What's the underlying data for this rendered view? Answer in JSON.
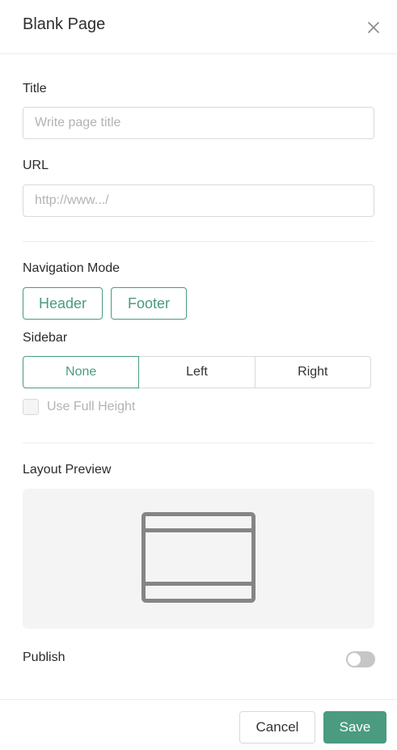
{
  "dialog": {
    "title": "Blank Page",
    "close_icon": "close-icon"
  },
  "form": {
    "title_label": "Title",
    "title_placeholder": "Write page title",
    "title_value": "",
    "url_label": "URL",
    "url_placeholder": "http://www.../",
    "url_value": "",
    "navigation_label": "Navigation Mode",
    "navigation_options": [
      "Header",
      "Footer"
    ],
    "sidebar_label": "Sidebar",
    "sidebar_options": [
      "None",
      "Left",
      "Right"
    ],
    "sidebar_selected": "None",
    "full_height_label": "Use Full Height",
    "full_height_checked": false,
    "full_height_disabled": true,
    "layout_preview_label": "Layout Preview",
    "layout_preview_icon": "layout-header-footer-icon",
    "publish_label": "Publish",
    "publish_on": false
  },
  "footer": {
    "cancel_label": "Cancel",
    "save_label": "Save"
  },
  "colors": {
    "accent": "#4a9b7f",
    "border": "#d9d9d9",
    "preview_bg": "#f4f4f4",
    "toggle_off": "#c6c6c6"
  }
}
